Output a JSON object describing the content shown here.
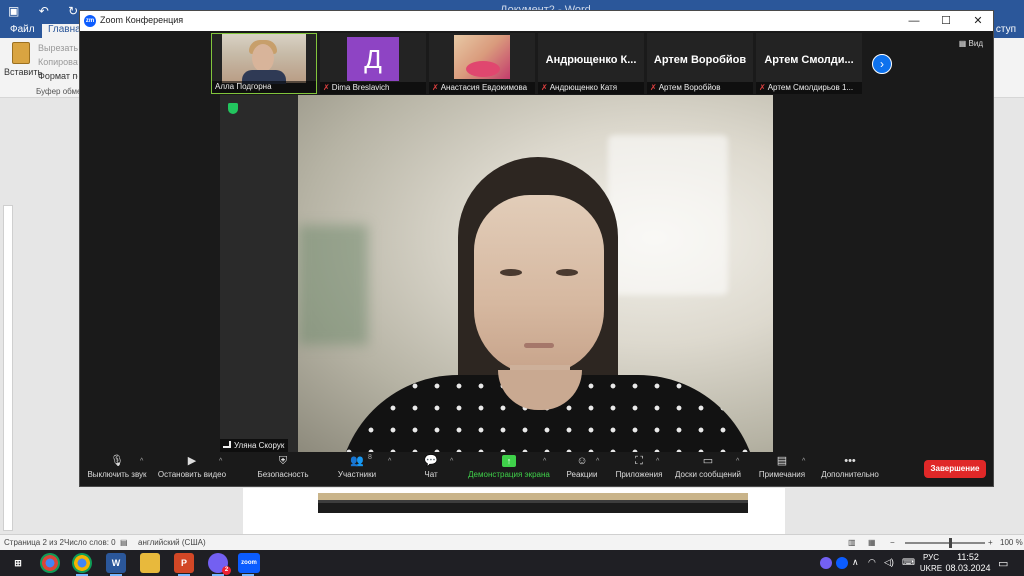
{
  "word": {
    "title": "Документ2 - Word",
    "tabs": [
      "Файл",
      "Главная",
      "ступ"
    ],
    "clipboard": {
      "paste_label": "Вставить",
      "cut": "Вырезать",
      "copy": "Копировать",
      "format": "Формат по образцу",
      "group_label": "Буфер обмена"
    },
    "status": {
      "page": "Страница 2 из 2",
      "words": "Число слов: 0",
      "language": "английский (США)",
      "zoom": "100 %"
    }
  },
  "zoom": {
    "window_title": "Zoom Конференция",
    "window_controls": {
      "minimize": "—",
      "maximize": "☐",
      "close": "✕"
    },
    "view_label": "Вид",
    "participants_strip": [
      {
        "name": "Алла Подгорна",
        "muted": false,
        "type": "video"
      },
      {
        "name": "Dima Breslavich",
        "muted": true,
        "type": "avatar",
        "initial": "Д"
      },
      {
        "name": "Анастасия Евдокимова",
        "muted": true,
        "type": "photo"
      },
      {
        "name": "Андрющенко Катя",
        "muted": true,
        "type": "text",
        "big_name": "Андрющенко К..."
      },
      {
        "name": "Артем Воробйов",
        "muted": true,
        "type": "text",
        "big_name": "Артем Воробйов"
      },
      {
        "name": "Артем Смолдирьов 1...",
        "muted": true,
        "type": "text",
        "big_name": "Артем Смолди..."
      }
    ],
    "active_speaker": "Уляна Скорук",
    "toolbar": {
      "mute": "Выключить звук",
      "video": "Остановить видео",
      "security": "Безопасность",
      "participants": "Участники",
      "participants_count": "8",
      "chat": "Чат",
      "share": "Демонстрация экрана",
      "reactions": "Реакции",
      "apps": "Приложения",
      "whiteboards": "Доски сообщений",
      "notes": "Примечания",
      "more": "Дополнительно",
      "end": "Завершение"
    }
  },
  "taskbar": {
    "language": "РУС",
    "layout": "UKRE",
    "time": "11:52",
    "date": "08.03.2024",
    "viber_badge": "2"
  }
}
